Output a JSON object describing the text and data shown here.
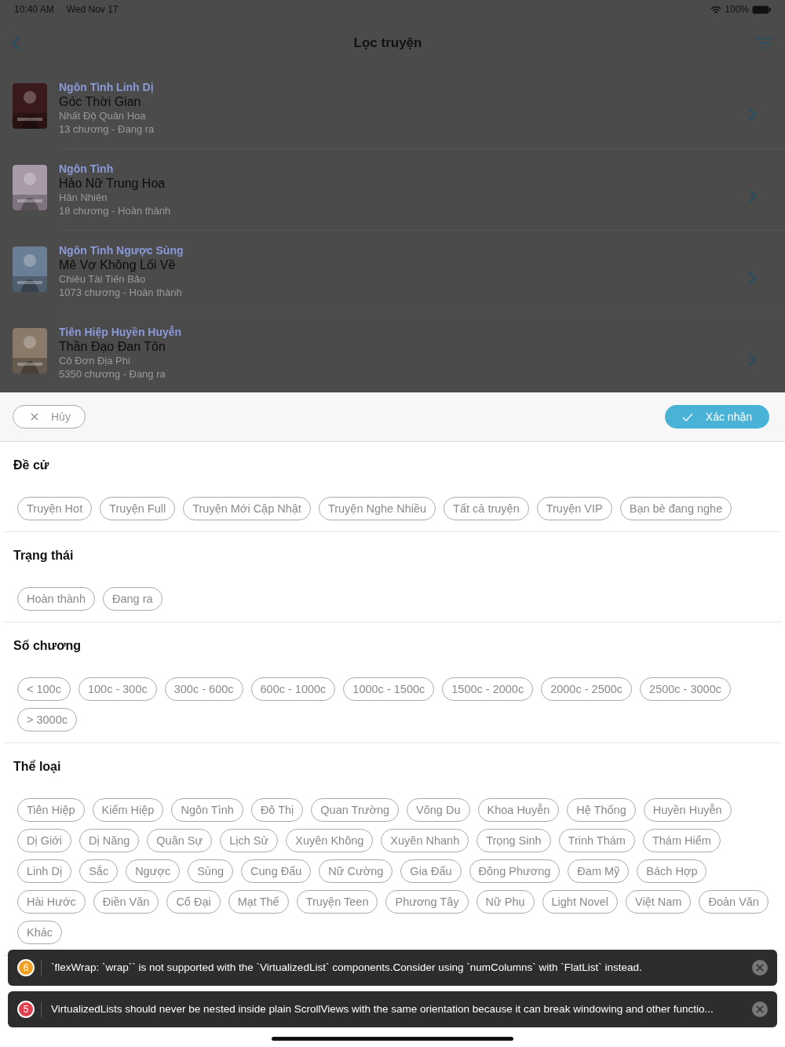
{
  "status_bar": {
    "time": "10:40 AM",
    "date": "Wed Nov 17",
    "battery": "100%"
  },
  "nav": {
    "title": "Lọc truyện"
  },
  "stories": [
    {
      "genre": "Ngôn Tình Linh Dị",
      "title": "Góc Thời Gian",
      "author": "Nhất Độ Quân Hoa",
      "info": "13 chương - Đang ra",
      "color": "#3a1a1a"
    },
    {
      "genre": "Ngôn Tình",
      "title": "Hảo Nữ Trung Hoa",
      "author": "Hân Nhiên",
      "info": "18 chương - Hoàn thành",
      "color": "#a89aa8"
    },
    {
      "genre": "Ngôn Tình Ngược Sủng",
      "title": "Mê Vợ Không Lối Về",
      "author": "Chiêu Tài Tiến Bảo",
      "info": "1073 chương - Hoàn thành",
      "color": "#6a7f95"
    },
    {
      "genre": "Tiên Hiệp Huyền Huyễn",
      "title": "Thần Đạo Đan Tôn",
      "author": "Cô Đơn Địa Phi",
      "info": "5350 chương - Đang ra",
      "color": "#8a7a6a"
    }
  ],
  "sheet": {
    "cancel": "Hủy",
    "confirm": "Xác nhận"
  },
  "sections": [
    {
      "title": "Đề cử",
      "chips": [
        "Truyện Hot",
        "Truyện Full",
        "Truyện Mới Cập Nhật",
        "Truyện Nghe Nhiều",
        "Tất cả truyện",
        "Truyện VIP",
        "Bạn bè đang nghe"
      ]
    },
    {
      "title": "Trạng thái",
      "chips": [
        "Hoàn thành",
        "Đang ra"
      ]
    },
    {
      "title": "Số chương",
      "chips": [
        "< 100c",
        "100c - 300c",
        "300c - 600c",
        "600c - 1000c",
        "1000c - 1500c",
        "1500c - 2000c",
        "2000c - 2500c",
        "2500c - 3000c",
        "> 3000c"
      ]
    },
    {
      "title": "Thể loại",
      "chips": [
        "Tiên Hiệp",
        "Kiếm Hiệp",
        "Ngôn Tình",
        "Đô Thị",
        "Quan Trường",
        "Võng Du",
        "Khoa Huyễn",
        "Hệ Thống",
        "Huyền Huyễn",
        "Dị Giới",
        "Dị Năng",
        "Quân Sự",
        "Lịch Sử",
        "Xuyên Không",
        "Xuyên Nhanh",
        "Trọng Sinh",
        "Trinh Thám",
        "Thám Hiểm",
        "Linh Dị",
        "Sắc",
        "Ngược",
        "Sủng",
        "Cung Đấu",
        "Nữ Cường",
        "Gia Đấu",
        "Đông Phương",
        "Đam Mỹ",
        "Bách Hợp",
        "Hài Hước",
        "Điền Văn",
        "Cổ Đại",
        "Mạt Thế",
        "Truyện Teen",
        "Phương Tây",
        "Nữ Phụ",
        "Light Novel",
        "Việt Nam",
        "Đoản Văn",
        "Khác"
      ]
    }
  ],
  "toasts": [
    {
      "count": "6",
      "color": "#f0a020",
      "message": "`flexWrap: `wrap`` is not supported with the `VirtualizedList` components.Consider using `numColumns` with `FlatList` instead."
    },
    {
      "count": "5",
      "color": "#e04050",
      "message": "VirtualizedLists should never be nested inside plain ScrollViews with the same orientation because it can break windowing and other functio..."
    }
  ]
}
